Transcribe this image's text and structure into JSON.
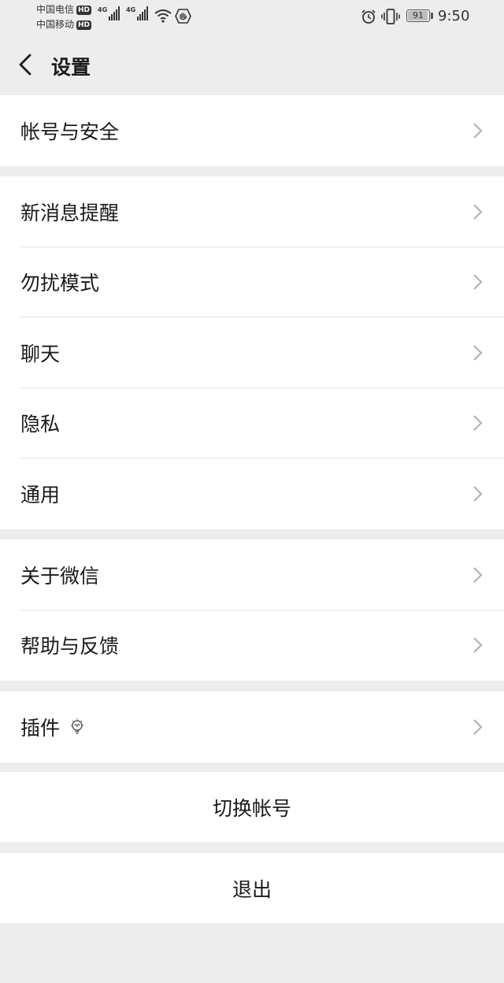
{
  "status_bar": {
    "carrier_1": "中国电信",
    "carrier_2": "中国移动",
    "hd_badge": "HD",
    "network_1": "4G",
    "network_2": "4G",
    "battery_level": "91",
    "time": "9:50"
  },
  "header": {
    "title": "设置",
    "back_icon": "chevron-left-icon"
  },
  "groups": [
    {
      "items": [
        {
          "label": "帐号与安全"
        }
      ]
    },
    {
      "items": [
        {
          "label": "新消息提醒"
        },
        {
          "label": "勿扰模式"
        },
        {
          "label": "聊天"
        },
        {
          "label": "隐私"
        },
        {
          "label": "通用"
        }
      ]
    },
    {
      "items": [
        {
          "label": "关于微信"
        },
        {
          "label": "帮助与反馈"
        }
      ]
    },
    {
      "items": [
        {
          "label": "插件",
          "icon": "lightbulb-icon"
        }
      ]
    }
  ],
  "actions": {
    "switch_account": "切换帐号",
    "logout": "退出"
  },
  "colors": {
    "page_background": "#ededed",
    "cell_background": "#ffffff",
    "text": "#1a1a1a",
    "chevron": "#b2b2b2"
  }
}
